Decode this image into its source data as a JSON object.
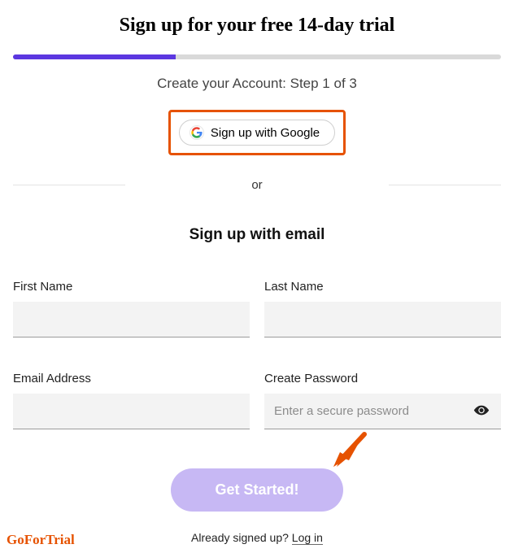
{
  "heading": "Sign up for your free 14-day trial",
  "step_text": "Create your Account: Step 1 of 3",
  "google_button": "Sign up with Google",
  "divider": "or",
  "email_heading": "Sign up with email",
  "fields": {
    "first_name": {
      "label": "First Name",
      "value": ""
    },
    "last_name": {
      "label": "Last Name",
      "value": ""
    },
    "email": {
      "label": "Email Address",
      "value": ""
    },
    "password": {
      "label": "Create Password",
      "placeholder": "Enter a secure password",
      "value": ""
    }
  },
  "submit_label": "Get Started!",
  "already_text": "Already signed up? ",
  "login_link": "Log in",
  "brand": "GoForTrial",
  "colors": {
    "accent": "#5b37e0",
    "highlight": "#e65200",
    "button": "#c7b8f4"
  }
}
